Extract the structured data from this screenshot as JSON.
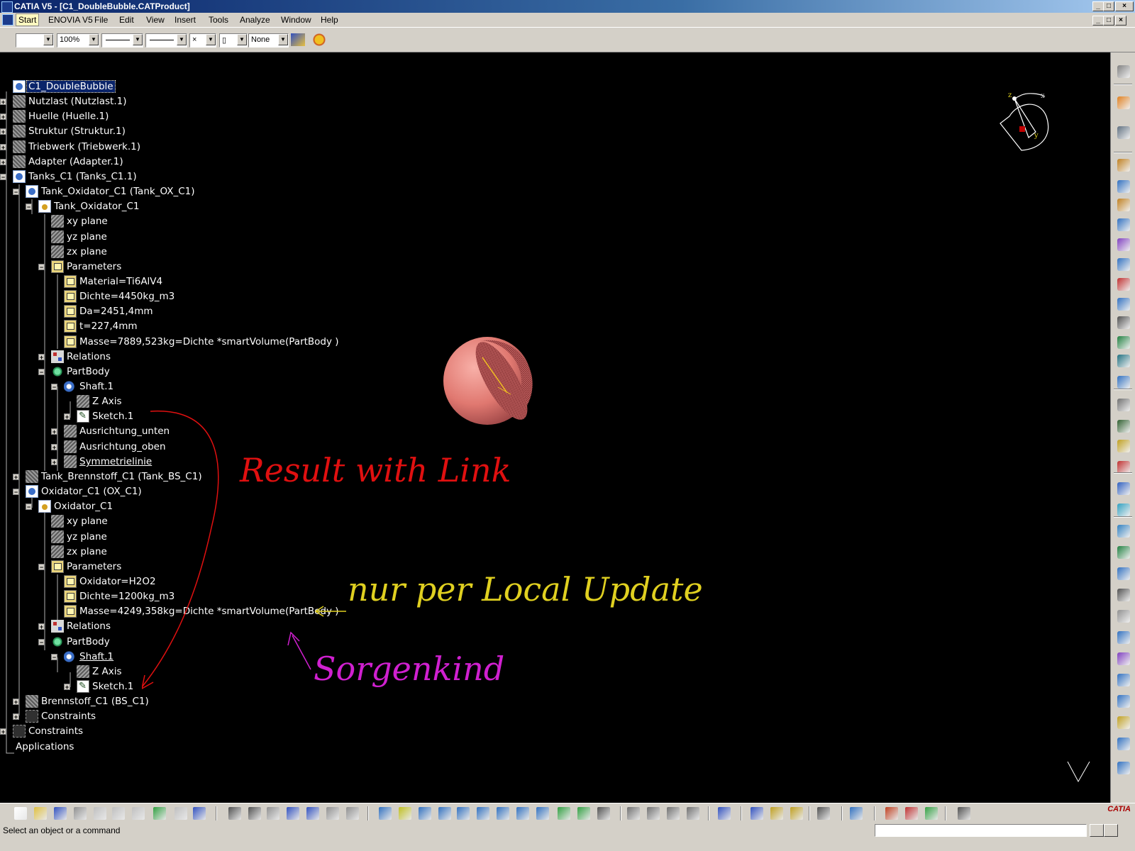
{
  "window": {
    "title": "CATIA V5 - [C1_DoubleBubble.CATProduct]"
  },
  "menu": {
    "items": [
      "Start",
      "ENOVIA V5",
      "File",
      "Edit",
      "View",
      "Insert",
      "Tools",
      "Analyze",
      "Window",
      "Help"
    ]
  },
  "format_toolbar": {
    "zoom": "100%",
    "layer": "None"
  },
  "tree": {
    "nodes": [
      "C1_DoubleBubble",
      "Nutzlast (Nutzlast.1)",
      "Huelle (Huelle.1)",
      "Struktur (Struktur.1)",
      "Triebwerk (Triebwerk.1)",
      "Adapter (Adapter.1)",
      "Tanks_C1 (Tanks_C1.1)",
      "Tank_Oxidator_C1 (Tank_OX_C1)",
      "Tank_Oxidator_C1",
      "xy plane",
      "yz plane",
      "zx plane",
      "Parameters",
      "Material=Ti6AlV4",
      "Dichte=4450kg_m3",
      "Da=2451,4mm",
      "t=227,4mm",
      "Masse=7889,523kg=Dichte *smartVolume(PartBody )",
      "Relations",
      "PartBody",
      "Shaft.1",
      "Z Axis",
      "Sketch.1",
      "Ausrichtung_unten",
      "Ausrichtung_oben",
      "Symmetrielinie",
      "Tank_Brennstoff_C1 (Tank_BS_C1)",
      "Oxidator_C1 (OX_C1)",
      "Oxidator_C1",
      "xy plane",
      "yz plane",
      "zx plane",
      "Parameters",
      "Oxidator=H2O2",
      "Dichte=1200kg_m3",
      "Masse=4249,358kg=Dichte *smartVolume(PartBody )",
      "Relations",
      "PartBody",
      "Shaft.1",
      "Z Axis",
      "Sketch.1",
      "Brennstoff_C1 (BS_C1)",
      "Constraints",
      "Constraints",
      "Applications"
    ]
  },
  "annotations": {
    "result_link": "Result with Link",
    "local_update": "nur per Local Update",
    "sorgenkind": "Sorgenkind"
  },
  "compass": {
    "x": "x",
    "y": "y",
    "z": "z"
  },
  "status": {
    "message": "Select an object or a command"
  },
  "brand": {
    "logo": "CATIA"
  },
  "colors": {
    "viewport_bg": "#000000",
    "annot_red": "#e01010",
    "annot_yellow": "#e0d020",
    "annot_magenta": "#d020d0",
    "sphere": "#e87878"
  }
}
